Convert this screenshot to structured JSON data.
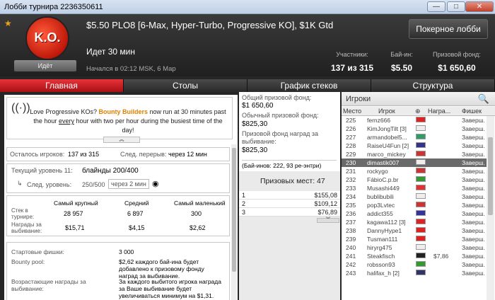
{
  "window": {
    "title": "Лобби турнира 2236350611",
    "btn_min": "—",
    "btn_max": "□",
    "btn_close": "✕"
  },
  "header": {
    "logo_text": "K.O.",
    "status_badge": "Идёт",
    "title": "$5.50 PLO8 [6-Max, Hyper-Turbo, Progressive KO], $1K Gtd",
    "lobby_button": "Покерное лобби",
    "going": "Идет 30 мин",
    "started": "Начался в 02:12 MSK, 6 Мар",
    "stats": [
      {
        "label": "Участники:",
        "value": "137 из 315"
      },
      {
        "label": "Бай-ин:",
        "value": "$5.50"
      },
      {
        "label": "Призовой фонд:",
        "value": "$1 650,60"
      }
    ]
  },
  "tabs": [
    "Главная",
    "Столы",
    "График стеков",
    "Структура"
  ],
  "promo": {
    "pre": "Love Progressive KOs?",
    "bb": "Bounty Builders",
    "mid": "now run at 30 minutes past the hour",
    "every": "every",
    "post": "hour with two per hour during the busiest time of the day!"
  },
  "left": {
    "remaining_label": "Осталось игроков:",
    "remaining_value": "137 из 315",
    "break_label": "След. перерыв:",
    "break_value": "через 12 мин",
    "level_label": "Текущий уровень 11:",
    "level_value": "блайнды 200/400",
    "next_label": "След. уровень:",
    "next_value": "250/500",
    "next_time": "через 2 мин",
    "stack_headers": [
      "Самый крупный",
      "Средний",
      "Самый маленький"
    ],
    "stack_row_label": "Стек в турнире:",
    "stack_values": [
      "28 957",
      "6 897",
      "300"
    ],
    "bounty_row_label": "Награды за выбивание:",
    "bounty_values": [
      "$15,71",
      "$4,15",
      "$2,62"
    ],
    "start_label": "Стартовые фишки:",
    "start_value": "3 000",
    "pool_label": "Bounty pool:",
    "pool_value": "$2,62 каждого бай-ина будет добавлено к призовому фонду наград за выбивание.",
    "ko_label": "Возрастающие награды за выбивание:",
    "ko_value": "За каждого выбитого игрока награда за Ваше выбивание будет увеличиваться минимум на $1,31."
  },
  "middle": {
    "total_label": "Общий призовой фонд:",
    "total_value": "$1 650,60",
    "regular_label": "Обычный призовой фонд:",
    "regular_value": "$825,30",
    "bounty_label": "Призовой фонд наград за выбивание:",
    "bounty_value": "$825,30",
    "buyins": "(Бай-инов: 222, 93 ре-энтри)",
    "places": "Призовых мест: 47",
    "prizes": [
      [
        "1",
        "$155,08"
      ],
      [
        "2",
        "$109,12"
      ],
      [
        "3",
        "$76,89"
      ]
    ]
  },
  "right": {
    "title": "Игроки",
    "cols": [
      "Место",
      "Игрок",
      "Награ...",
      "Фишек"
    ],
    "players": [
      {
        "place": "225",
        "name": "fernz666",
        "bounty": "",
        "status": "Заверш.",
        "flag": "#d22"
      },
      {
        "place": "226",
        "name": "KimJongTilt [3]",
        "bounty": "",
        "status": "Заверш.",
        "flag": "#eee"
      },
      {
        "place": "227",
        "name": "armandobel5...",
        "bounty": "",
        "status": "Заверш.",
        "flag": "#396"
      },
      {
        "place": "228",
        "name": "RaiseU4Fun [2]",
        "bounty": "",
        "status": "Заверш.",
        "flag": "#338"
      },
      {
        "place": "229",
        "name": "marco_mickey",
        "bounty": "",
        "status": "Заверш.",
        "flag": "#c33"
      },
      {
        "place": "230",
        "name": "dimastik007",
        "bounty": "",
        "status": "Заверш.",
        "flag": "#eee",
        "sel": true
      },
      {
        "place": "231",
        "name": "rockygo",
        "bounty": "",
        "status": "Заверш.",
        "flag": "#c33"
      },
      {
        "place": "232",
        "name": "FábioC.p.br",
        "bounty": "",
        "status": "Заверш.",
        "flag": "#393"
      },
      {
        "place": "233",
        "name": "Musashi449",
        "bounty": "",
        "status": "Заверш.",
        "flag": "#d33"
      },
      {
        "place": "234",
        "name": "bublibubili",
        "bounty": "",
        "status": "Заверш.",
        "flag": "#eee"
      },
      {
        "place": "235",
        "name": "pop3Lvtec",
        "bounty": "",
        "status": "Заверш.",
        "flag": "#c33"
      },
      {
        "place": "236",
        "name": "addict355",
        "bounty": "",
        "status": "Заверш.",
        "flag": "#339"
      },
      {
        "place": "237",
        "name": "kagawa112 [3]",
        "bounty": "",
        "status": "Заверш.",
        "flag": "#d22"
      },
      {
        "place": "238",
        "name": "DannyHype1",
        "bounty": "",
        "status": "Заверш.",
        "flag": "#d22"
      },
      {
        "place": "239",
        "name": "Tusman111",
        "bounty": "",
        "status": "Заверш.",
        "flag": "#d22"
      },
      {
        "place": "240",
        "name": "hiryrg475",
        "bounty": "",
        "status": "Заверш.",
        "flag": "#eee"
      },
      {
        "place": "241",
        "name": "Steakfisch",
        "bounty": "$7,86",
        "status": "Заверш.",
        "flag": "#222"
      },
      {
        "place": "242",
        "name": "robsson93",
        "bounty": "",
        "status": "Заверш.",
        "flag": "#393"
      },
      {
        "place": "243",
        "name": "halifax_h [2]",
        "bounty": "",
        "status": "Заверш.",
        "flag": "#336"
      }
    ]
  }
}
